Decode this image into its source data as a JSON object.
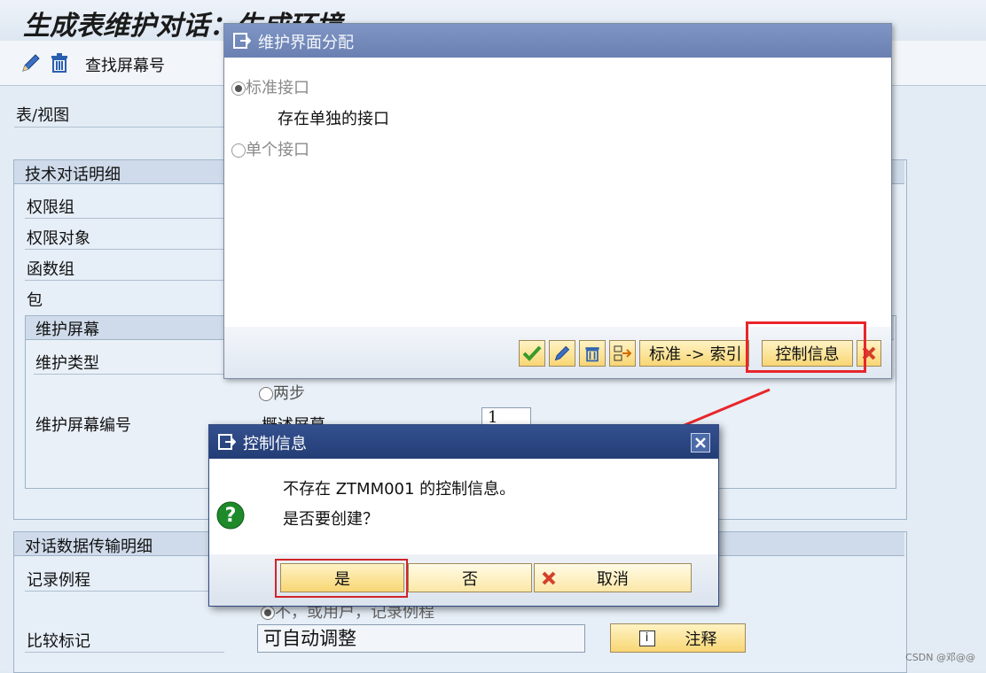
{
  "window": {
    "title": "生成表维护对话：生成环境",
    "toolbar": {
      "find_screen_label": "查找屏幕号"
    }
  },
  "main": {
    "table_view_label": "表/视图",
    "tech_group": {
      "title": "技术对话明细",
      "fields": [
        "权限组",
        "权限对象",
        "函数组",
        "包"
      ]
    },
    "maint_screen_group": {
      "title": "维护屏幕",
      "maint_type_label": "维护类型",
      "two_step_label": "两步",
      "screen_no_label": "维护屏幕编号",
      "overview_label": "概述屏幕",
      "overview_value": "1"
    },
    "transfer_group": {
      "title": "对话数据传输明细",
      "record_routine_label": "记录例程",
      "record_routine_option": "不，或用户，记录例程",
      "compare_flag_label": "比较标记",
      "compare_flag_value": "可自动调整",
      "note_button_label": "注释"
    }
  },
  "dialog_maint": {
    "title": "维护界面分配",
    "radio_standard": "标准接口",
    "standard_note": "存在单独的接口",
    "radio_single": "单个接口",
    "btn_std_index": "标准 -> 索引",
    "btn_control_info": "控制信息"
  },
  "dialog_control": {
    "title": "控制信息",
    "message_line1": "不存在 ZTMM001 的控制信息。",
    "message_line2": "是否要创建？",
    "btn_yes": "是",
    "btn_no": "否",
    "btn_cancel": "取消"
  },
  "watermark": "CSDN @邓@@",
  "colors": {
    "highlight_red": "#e8262b",
    "button_yellow": "#f8d674",
    "dialog_head": "#233d75"
  }
}
